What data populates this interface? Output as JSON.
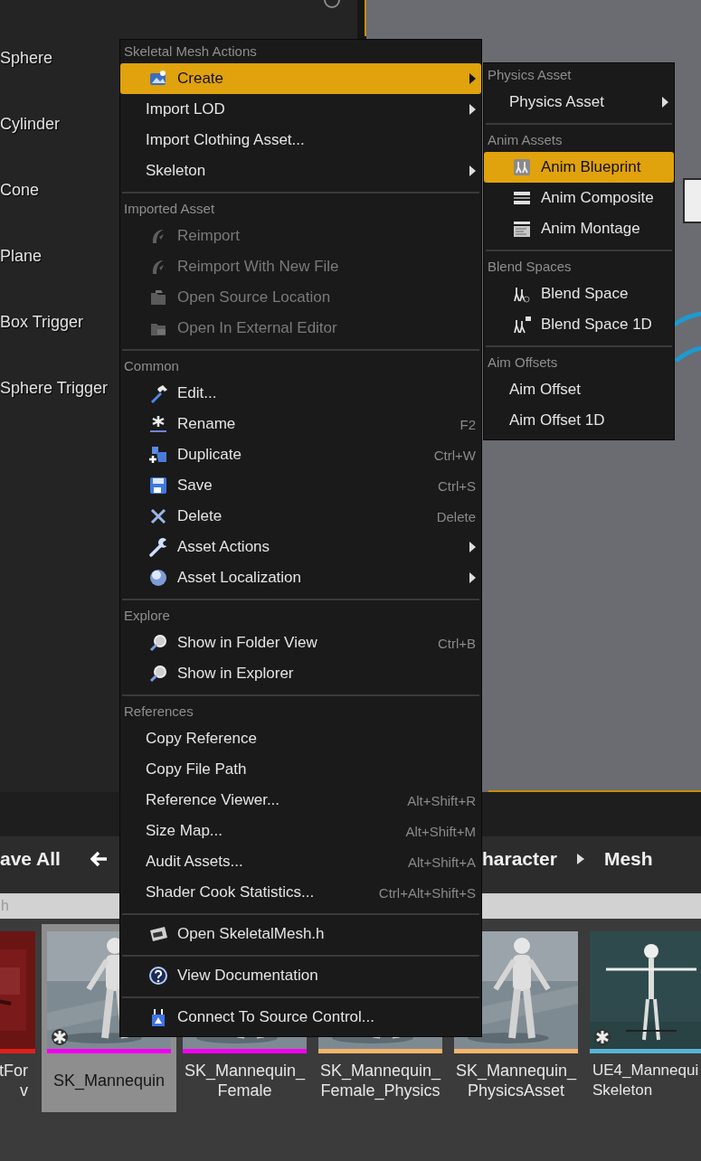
{
  "outliner": {
    "items": [
      {
        "label": "Sphere"
      },
      {
        "label": "Cylinder"
      },
      {
        "label": "Cone"
      },
      {
        "label": "Plane"
      },
      {
        "label": "Box Trigger"
      },
      {
        "label": "Sphere Trigger"
      }
    ]
  },
  "toolbar": {
    "save_all": "ave All",
    "breadcrumbs": [
      {
        "label": "haracter"
      },
      {
        "label": "Mesh"
      }
    ]
  },
  "search": {
    "placeholder": "h"
  },
  "assets": [
    {
      "label_lines": [
        "tFor",
        "v"
      ],
      "color": "#e0201a",
      "selected": false
    },
    {
      "label_lines": [
        "SK_Mannequin"
      ],
      "color": "#f000f0",
      "selected": true,
      "starred": true
    },
    {
      "label_lines": [
        "SK_Mannequin_",
        "Female"
      ],
      "color": "#f000f0",
      "selected": false,
      "starred": false
    },
    {
      "label_lines": [
        "SK_Mannequin_",
        "Female_Physics"
      ],
      "color": "#f5b46a",
      "selected": false,
      "starred": false
    },
    {
      "label_lines": [
        "SK_Mannequin_",
        "PhysicsAsset"
      ],
      "color": "#f5b46a",
      "selected": false,
      "starred": false
    },
    {
      "label_lines": [
        "UE4_Mannequi",
        "Skeleton"
      ],
      "color": "#5ab4d4",
      "selected": false,
      "starred": true
    }
  ],
  "context_menu": {
    "sections": [
      {
        "header": "Skeletal Mesh Actions",
        "items": [
          {
            "label": "Create",
            "submenu": true,
            "disabled": false,
            "selected": true
          },
          {
            "label": "Import LOD",
            "submenu": true,
            "disabled": false,
            "selected": false
          },
          {
            "label": "Import Clothing Asset...",
            "submenu": false,
            "disabled": false,
            "selected": false
          },
          {
            "label": "Skeleton",
            "submenu": true,
            "disabled": false,
            "selected": false
          }
        ]
      },
      {
        "header": "Imported Asset",
        "items": [
          {
            "label": "Reimport",
            "submenu": false,
            "disabled": true,
            "selected": false
          },
          {
            "label": "Reimport With New File",
            "submenu": false,
            "disabled": true,
            "selected": false
          },
          {
            "label": "Open Source Location",
            "submenu": false,
            "disabled": true,
            "selected": false
          },
          {
            "label": "Open In External Editor",
            "submenu": false,
            "disabled": true,
            "selected": false
          }
        ]
      },
      {
        "header": "Common",
        "items": [
          {
            "label": "Edit...",
            "submenu": false,
            "disabled": false,
            "selected": false
          },
          {
            "label": "Rename",
            "shortcut": "F2",
            "submenu": false,
            "disabled": false,
            "selected": false
          },
          {
            "label": "Duplicate",
            "shortcut": "Ctrl+W",
            "submenu": false,
            "disabled": false,
            "selected": false
          },
          {
            "label": "Save",
            "shortcut": "Ctrl+S",
            "submenu": false,
            "disabled": false,
            "selected": false
          },
          {
            "label": "Delete",
            "shortcut": "Delete",
            "submenu": false,
            "disabled": false,
            "selected": false
          },
          {
            "label": "Asset Actions",
            "submenu": true,
            "disabled": false,
            "selected": false
          },
          {
            "label": "Asset Localization",
            "submenu": true,
            "disabled": false,
            "selected": false
          }
        ]
      },
      {
        "header": "Explore",
        "items": [
          {
            "label": "Show in Folder View",
            "shortcut": "Ctrl+B",
            "submenu": false,
            "disabled": false,
            "selected": false
          },
          {
            "label": "Show in Explorer",
            "submenu": false,
            "disabled": false,
            "selected": false
          }
        ]
      },
      {
        "header": "References",
        "items": [
          {
            "label": "Copy Reference",
            "submenu": false,
            "disabled": false,
            "selected": false
          },
          {
            "label": "Copy File Path",
            "submenu": false,
            "disabled": false,
            "selected": false
          },
          {
            "label": "Reference Viewer...",
            "shortcut": "Alt+Shift+R",
            "submenu": false,
            "disabled": false,
            "selected": false
          },
          {
            "label": "Size Map...",
            "shortcut": "Alt+Shift+M",
            "submenu": false,
            "disabled": false,
            "selected": false
          },
          {
            "label": "Audit Assets...",
            "shortcut": "Alt+Shift+A",
            "submenu": false,
            "disabled": false,
            "selected": false
          },
          {
            "label": "Shader Cook Statistics...",
            "shortcut": "Ctrl+Alt+Shift+S",
            "submenu": false,
            "disabled": false,
            "selected": false
          }
        ]
      },
      {
        "items": [
          {
            "label": "Open SkeletalMesh.h",
            "disabled": false,
            "selected": false
          }
        ]
      },
      {
        "items": [
          {
            "label": "View Documentation",
            "disabled": false,
            "selected": false
          }
        ]
      },
      {
        "items": [
          {
            "label": "Connect To Source Control...",
            "disabled": false,
            "selected": false
          }
        ]
      }
    ]
  },
  "create_submenu": {
    "sections": [
      {
        "header": "Physics Asset",
        "items": [
          {
            "label": "Physics Asset",
            "submenu": true,
            "disabled": false,
            "selected": false
          }
        ]
      },
      {
        "header": "Anim Assets",
        "items": [
          {
            "label": "Anim Blueprint",
            "submenu": false,
            "disabled": false,
            "selected": true
          },
          {
            "label": "Anim Composite",
            "submenu": false,
            "disabled": false,
            "selected": false
          },
          {
            "label": "Anim Montage",
            "submenu": false,
            "disabled": false,
            "selected": false
          }
        ]
      },
      {
        "header": "Blend Spaces",
        "items": [
          {
            "label": "Blend Space",
            "submenu": false,
            "disabled": false,
            "selected": false
          },
          {
            "label": "Blend Space 1D",
            "submenu": false,
            "disabled": false,
            "selected": false
          }
        ]
      },
      {
        "header": "Aim Offsets",
        "items": [
          {
            "label": "Aim Offset",
            "submenu": false,
            "disabled": false,
            "selected": false
          },
          {
            "label": "Aim Offset 1D",
            "submenu": false,
            "disabled": false,
            "selected": false
          }
        ]
      }
    ]
  }
}
